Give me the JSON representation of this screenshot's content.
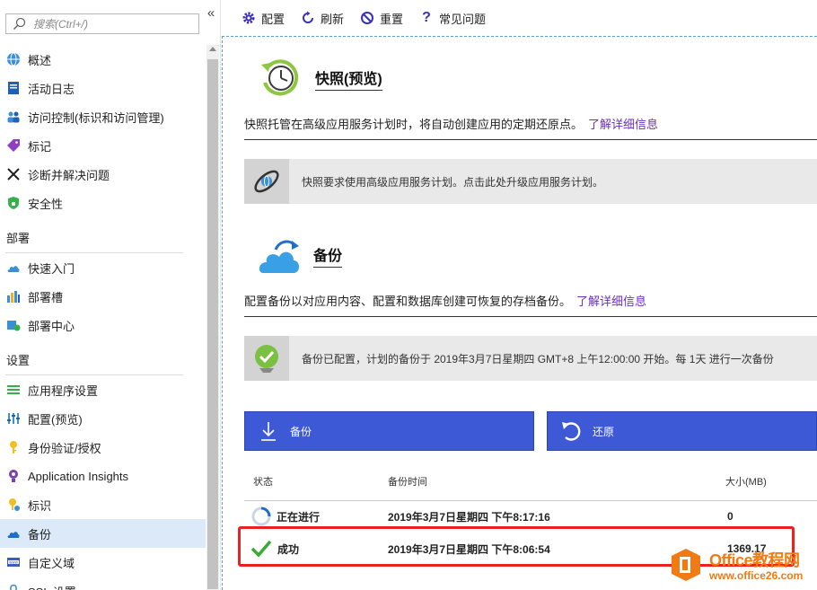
{
  "sidebar": {
    "search_placeholder": "搜索(Ctrl+/)",
    "collapse_glyph": "«",
    "items_top": [
      {
        "label": "概述",
        "icon": "globe-icon"
      },
      {
        "label": "活动日志",
        "icon": "log-icon"
      },
      {
        "label": "访问控制(标识和访问管理)",
        "icon": "users-icon"
      },
      {
        "label": "标记",
        "icon": "tag-icon"
      },
      {
        "label": "诊断并解决问题",
        "icon": "wrench-icon"
      },
      {
        "label": "安全性",
        "icon": "shield-icon"
      }
    ],
    "section_deploy": "部署",
    "items_deploy": [
      {
        "label": "快速入门",
        "icon": "cloud-icon"
      },
      {
        "label": "部署槽",
        "icon": "slots-icon"
      },
      {
        "label": "部署中心",
        "icon": "deploy-center-icon"
      }
    ],
    "section_settings": "设置",
    "items_settings": [
      {
        "label": "应用程序设置",
        "icon": "app-settings-icon"
      },
      {
        "label": "配置(预览)",
        "icon": "config-icon"
      },
      {
        "label": "身份验证/授权",
        "icon": "key-icon"
      },
      {
        "label": "Application Insights",
        "icon": "insights-icon"
      },
      {
        "label": "标识",
        "icon": "identity-icon"
      },
      {
        "label": "备份",
        "icon": "backup-cloud-icon",
        "active": true
      },
      {
        "label": "自定义域",
        "icon": "domain-icon"
      },
      {
        "label": "SSL 设置",
        "icon": "ssl-icon"
      }
    ]
  },
  "toolbar": {
    "configure": "配置",
    "refresh": "刷新",
    "reset": "重置",
    "faq": "常见问题"
  },
  "snapshot": {
    "title": "快照(预览)",
    "desc": "快照托管在高级应用服务计划时，将自动创建应用的定期还原点。",
    "learn_more": "了解详细信息",
    "banner": "快照要求使用高级应用服务计划。点击此处升级应用服务计划。"
  },
  "backup": {
    "title": "备份",
    "desc": "配置备份以对应用内容、配置和数据库创建可恢复的存档备份。",
    "learn_more": "了解详细信息",
    "banner": "备份已配置，计划的备份于 2019年3月7日星期四 GMT+8 上午12:00:00 开始。每 1天 进行一次备份",
    "backup_button": "备份",
    "restore_button": "还原"
  },
  "table": {
    "headers": [
      "状态",
      "备份时间",
      "大小(MB)"
    ],
    "rows": [
      {
        "status": "正在进行",
        "time": "2019年3月7日星期四 下午8:17:16",
        "size": "0"
      },
      {
        "status": "成功",
        "time": "2019年3月7日星期四 下午8:06:54",
        "size": "1369.17"
      }
    ]
  },
  "watermark": {
    "brand": "Office",
    "brand_cn": "教程网",
    "url": "www.office26.com"
  },
  "colors": {
    "accent": "#3d59d6",
    "link": "#6b2fbf",
    "highlight": "#e8231f",
    "active_nav": "#dbe9f8"
  }
}
